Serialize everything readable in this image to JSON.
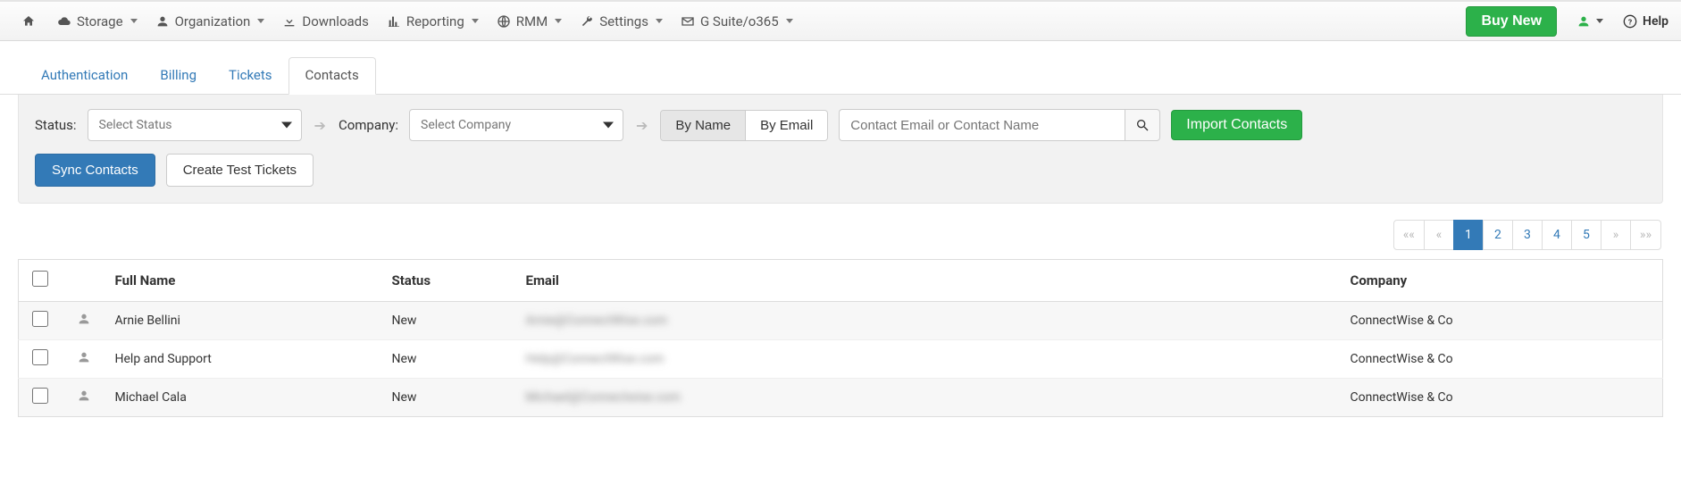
{
  "nav": {
    "items": [
      {
        "label": "Storage",
        "icon": "cloud",
        "caret": true
      },
      {
        "label": "Organization",
        "icon": "user",
        "caret": true
      },
      {
        "label": "Downloads",
        "icon": "download",
        "caret": false
      },
      {
        "label": "Reporting",
        "icon": "bar",
        "caret": true
      },
      {
        "label": "RMM",
        "icon": "globe",
        "caret": true
      },
      {
        "label": "Settings",
        "icon": "wrench",
        "caret": true
      },
      {
        "label": "G Suite/o365",
        "icon": "mail",
        "caret": true
      }
    ],
    "buy": "Buy New",
    "help": "Help"
  },
  "tabs": [
    "Authentication",
    "Billing",
    "Tickets",
    "Contacts"
  ],
  "active_tab": "Contacts",
  "filters": {
    "status_label": "Status:",
    "status_placeholder": "Select Status",
    "company_label": "Company:",
    "company_placeholder": "Select Company",
    "seg_byname": "By Name",
    "seg_byemail": "By Email",
    "search_placeholder": "Contact Email or Contact Name",
    "import_btn": "Import Contacts",
    "sync_btn": "Sync Contacts",
    "create_tickets_btn": "Create Test Tickets"
  },
  "pagination": {
    "first": "««",
    "prev": "«",
    "pages": [
      "1",
      "2",
      "3",
      "4",
      "5"
    ],
    "active": "1",
    "next": "»",
    "last": "»»"
  },
  "table": {
    "headers": {
      "name": "Full Name",
      "status": "Status",
      "email": "Email",
      "company": "Company"
    },
    "rows": [
      {
        "name": "Arnie Bellini",
        "status": "New",
        "email": "Arnie@ConnectWise.com",
        "company": "ConnectWise & Co"
      },
      {
        "name": "Help and Support",
        "status": "New",
        "email": "Help@ConnectWise.com",
        "company": "ConnectWise & Co"
      },
      {
        "name": "Michael Cala",
        "status": "New",
        "email": "Michael@Connectwise.com",
        "company": "ConnectWise & Co"
      }
    ]
  }
}
